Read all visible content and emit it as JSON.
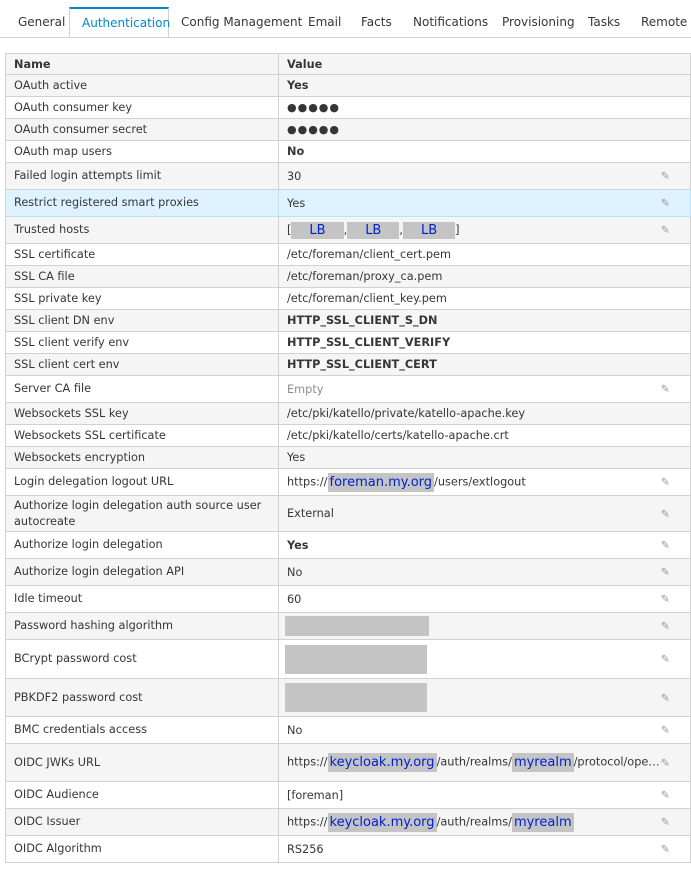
{
  "tabs": [
    {
      "label": "General",
      "active": false
    },
    {
      "label": "Authentication",
      "active": true
    },
    {
      "label": "Config Management",
      "active": false
    },
    {
      "label": "Email",
      "active": false
    },
    {
      "label": "Facts",
      "active": false
    },
    {
      "label": "Notifications",
      "active": false
    },
    {
      "label": "Provisioning",
      "active": false
    },
    {
      "label": "Tasks",
      "active": false
    },
    {
      "label": "Remote E",
      "active": false
    }
  ],
  "table": {
    "headers": {
      "name": "Name",
      "value": "Value"
    },
    "rows": [
      {
        "name": "OAuth active",
        "value": "Yes",
        "bold": true,
        "editable": false
      },
      {
        "name": "OAuth consumer key",
        "value": "●●●●●",
        "editable": false
      },
      {
        "name": "OAuth consumer secret",
        "value": "●●●●●",
        "editable": false
      },
      {
        "name": "OAuth map users",
        "value": "No",
        "bold": true,
        "editable": false
      },
      {
        "name": "Failed login attempts limit",
        "value": "30",
        "editable": true
      },
      {
        "name": "Restrict registered smart proxies",
        "value": "Yes",
        "editable": true,
        "highlight": true
      },
      {
        "name": "Trusted hosts",
        "value_parts": [
          "[",
          "LB",
          ",",
          "LB",
          ",",
          "LB",
          "]"
        ],
        "editable": true
      },
      {
        "name": "SSL certificate",
        "value": "/etc/foreman/client_cert.pem",
        "editable": false
      },
      {
        "name": "SSL CA file",
        "value": "/etc/foreman/proxy_ca.pem",
        "editable": false
      },
      {
        "name": "SSL private key",
        "value": "/etc/foreman/client_key.pem",
        "editable": false
      },
      {
        "name": "SSL client DN env",
        "value": "HTTP_SSL_CLIENT_S_DN",
        "bold": true,
        "editable": false
      },
      {
        "name": "SSL client verify env",
        "value": "HTTP_SSL_CLIENT_VERIFY",
        "bold": true,
        "editable": false
      },
      {
        "name": "SSL client cert env",
        "value": "HTTP_SSL_CLIENT_CERT",
        "bold": true,
        "editable": false
      },
      {
        "name": "Server CA file",
        "value": "Empty",
        "muted": true,
        "editable": true
      },
      {
        "name": "Websockets SSL key",
        "value": "/etc/pki/katello/private/katello-apache.key",
        "editable": false
      },
      {
        "name": "Websockets SSL certificate",
        "value": "/etc/pki/katello/certs/katello-apache.crt",
        "editable": false
      },
      {
        "name": "Websockets encryption",
        "value": "Yes",
        "editable": false
      },
      {
        "name": "Login delegation logout URL",
        "value_parts": [
          "https://",
          "foreman.my.org",
          "/users/extlogout"
        ],
        "editable": true
      },
      {
        "name": "Authorize login delegation auth source user autocreate",
        "value": "External",
        "editable": true
      },
      {
        "name": "Authorize login delegation",
        "value": "Yes",
        "bold": true,
        "editable": true
      },
      {
        "name": "Authorize login delegation API",
        "value": "No",
        "editable": true
      },
      {
        "name": "Idle timeout",
        "value": "60",
        "editable": true
      },
      {
        "name": "Password hashing algorithm",
        "value": "",
        "redacted": true,
        "editable": true
      },
      {
        "name": "BCrypt password cost",
        "value": "",
        "redacted": true,
        "editable": true
      },
      {
        "name": "PBKDF2 password cost",
        "value": "",
        "redacted": true,
        "editable": true
      },
      {
        "name": "BMC credentials access",
        "value": "No",
        "editable": true
      },
      {
        "name": "OIDC JWKs URL",
        "value_parts": [
          "https://",
          "keycloak.my.org",
          "/auth/realms/",
          "myrealm",
          "/protocol/openid-c..."
        ],
        "editable": true
      },
      {
        "name": "OIDC Audience",
        "value": "[foreman]",
        "editable": true
      },
      {
        "name": "OIDC Issuer",
        "value_parts": [
          "https://",
          "keycloak.my.org",
          "/auth/realms/",
          "myrealm"
        ],
        "editable": true
      },
      {
        "name": "OIDC Algorithm",
        "value": "RS256",
        "editable": true
      }
    ]
  },
  "icons": {
    "edit": "pencil-icon"
  }
}
